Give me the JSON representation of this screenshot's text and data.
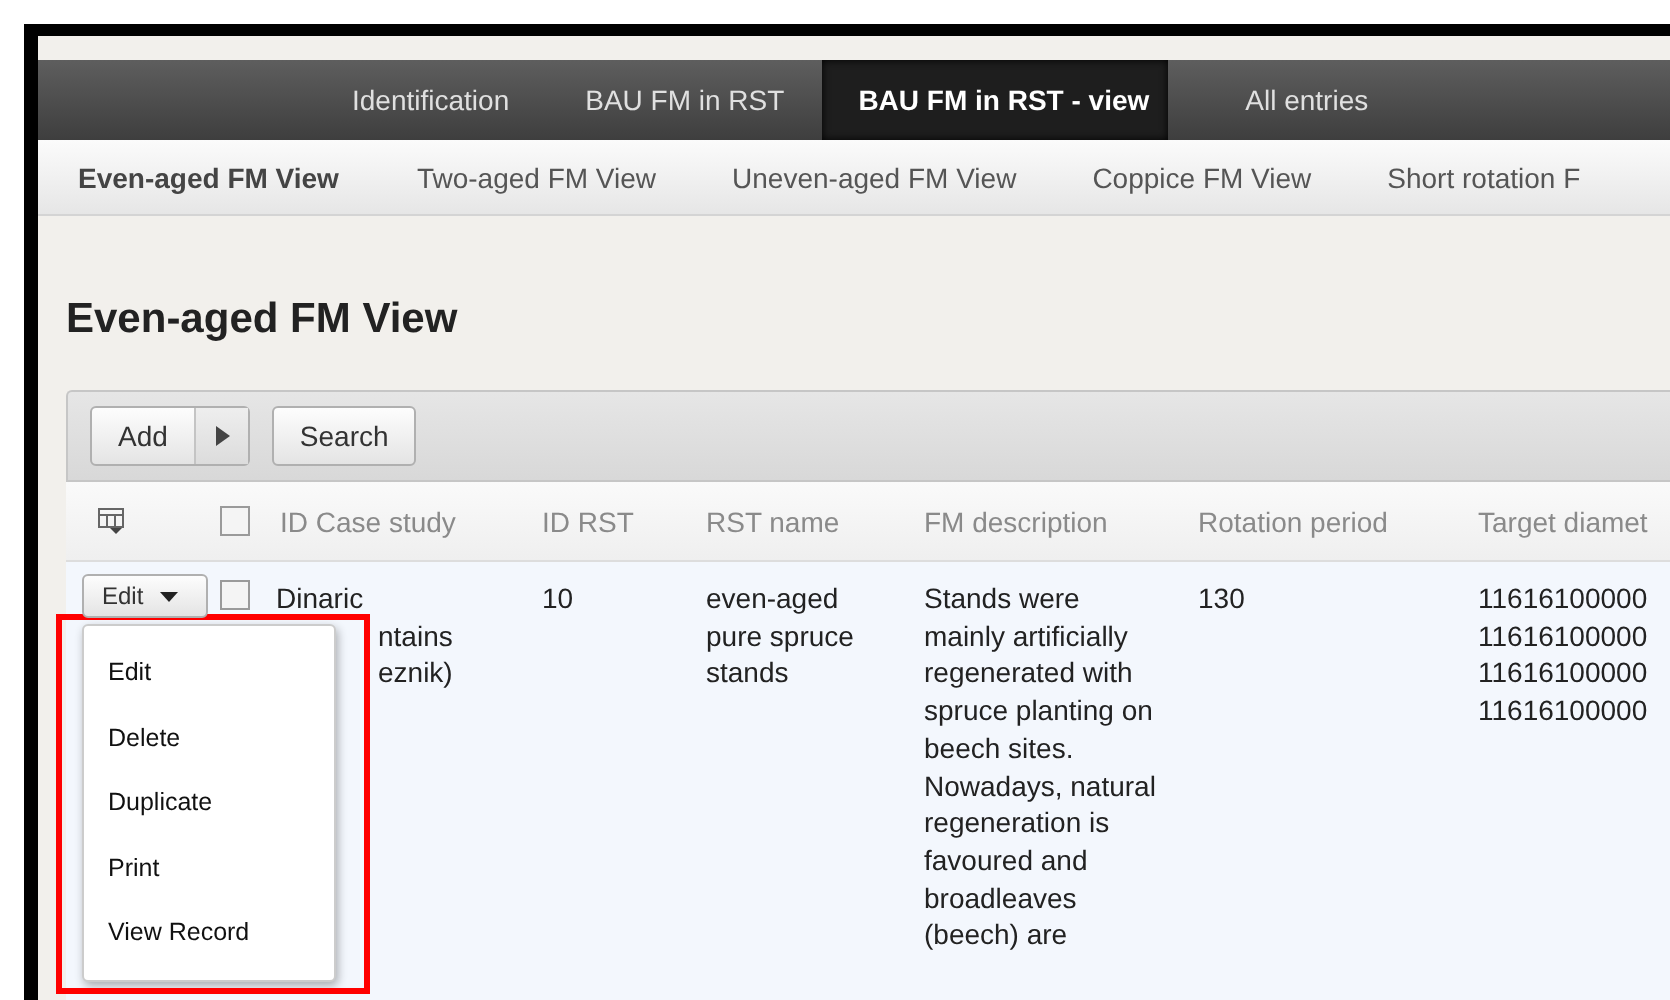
{
  "nav_tabs": [
    {
      "label": "Identification",
      "selected": false
    },
    {
      "label": "BAU FM in RST",
      "selected": false
    },
    {
      "label": "BAU FM in RST - view",
      "selected": true
    },
    {
      "label": "All entries",
      "selected": false
    }
  ],
  "sub_tabs": [
    {
      "label": "Even-aged FM View",
      "selected": true
    },
    {
      "label": "Two-aged FM View",
      "selected": false
    },
    {
      "label": "Uneven-aged FM View",
      "selected": false
    },
    {
      "label": "Coppice FM View",
      "selected": false
    },
    {
      "label": "Short rotation F",
      "selected": false
    }
  ],
  "title": "Even-aged FM View",
  "toolbar": {
    "add_label": "Add",
    "search_label": "Search"
  },
  "table": {
    "select_all_checked": false,
    "columns": [
      "ID Case study",
      "ID RST",
      "RST name",
      "FM description",
      "Rotation period",
      "Target diamet"
    ],
    "rows": [
      {
        "edit_label": "Edit",
        "checked": false,
        "case_study_lines": [
          "Dinaric",
          "ntains",
          "eznik)"
        ],
        "id_rst": "10",
        "rst_name": "even-aged pure spruce stands",
        "fm_description": "Stands were mainly artificially regenerated with spruce planting on beech sites. Nowadays, natural regeneration is favoured and broadleaves (beech) are",
        "rotation_period": "130",
        "target_diameter_lines": [
          "11616100000",
          "11616100000",
          "11616100000",
          "11616100000"
        ]
      }
    ]
  },
  "row_menu": {
    "items": [
      "Edit",
      "Delete",
      "Duplicate",
      "Print",
      "View Record"
    ]
  },
  "annotation": {
    "kind": "highlight"
  }
}
